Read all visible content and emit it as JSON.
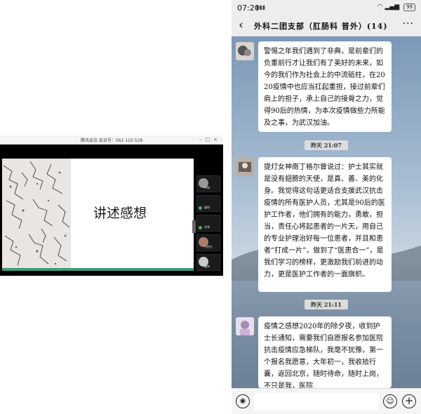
{
  "meeting": {
    "window_title": "腾讯会议 会议号：562 110 528",
    "slide_title": "讲述感想",
    "participants": [
      {
        "name": "齐桐"
      },
      {
        "name": "翟昭"
      },
      {
        "name": "张琴"
      },
      {
        "name": "王柏行"
      },
      {
        "name": "魏婷"
      }
    ]
  },
  "status_bar": {
    "time": "07:20",
    "battery": "99"
  },
  "chat": {
    "title": "外科二团支部（肛肠科 普外）(14)",
    "messages": [
      {
        "text": "警惕之年我们遇到了非典，是前辈们的负重前行才让我们有了美好的未来，如今的我们作为社会上的中流砥柱，在2020疫情中也应当扛起重担，接过前辈们肩上的担子，承上自己的接骨之力，觉得90后的热情，为本次疫情做些力所能及之事，为武汉加油。"
      },
      {
        "timestamp": "昨天 21:07"
      },
      {
        "text": "提灯女神南丁格尔曾说过：护士其实就是没有翅膀的天使，是真、善、美的化身。我觉得这句话更适合支援武汉抗击疫情的所有医护人员，尤其是90后的医护工作者，他们拥有的能力，勇敢，担当，责任心将起患者的一片天，用自己的专业护理治好每一位患者，并且和患者“打成一片”，做到了“医患合一”，是我们学习的榜样，更激励我们前进的动力，更是医护工作者的一面旗帜。"
      },
      {
        "timestamp": "昨天 21:11"
      },
      {
        "text": "疫情之感想2020年的除夕夜，收到护士长通知，需要我们自愿报名参加医院抗击疫情应急梯队，我毫不犹豫，第一个报名我愿意，大年初一，我收拾行囊，返回北京，随时待命，随时上岗，不只是我，医院"
      }
    ]
  },
  "icons": {
    "back": "chevron-left-icon",
    "more": "more-icon",
    "voice": "voice-icon",
    "emoji": "emoji-icon",
    "plus": "plus-icon"
  }
}
